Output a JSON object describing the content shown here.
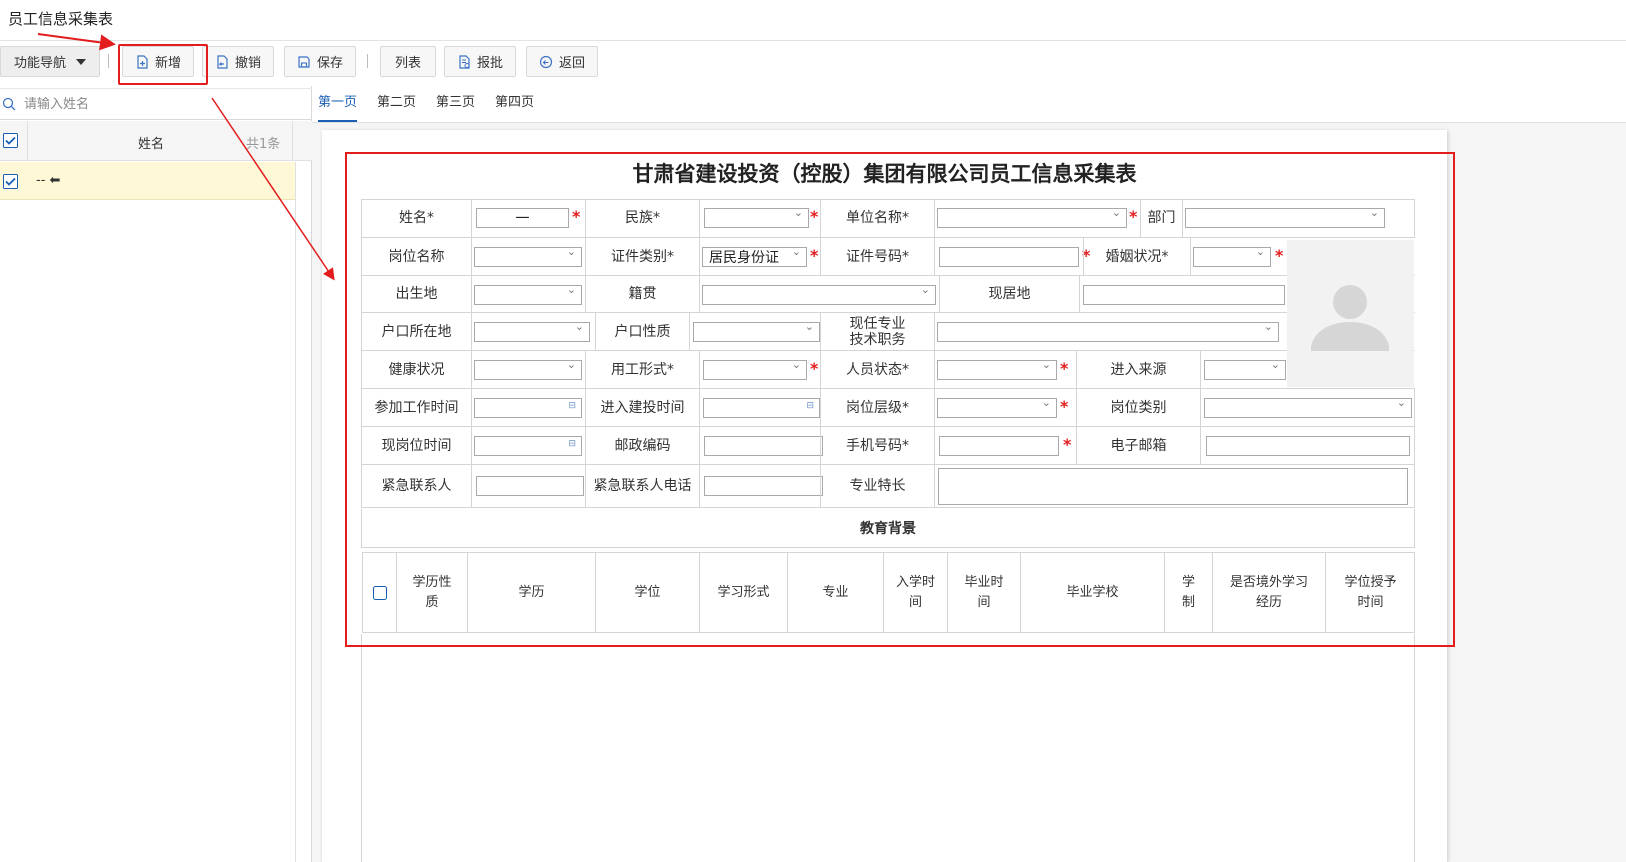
{
  "app": {
    "title": "员工信息采集表"
  },
  "toolbar": {
    "nav_label": "功能导航",
    "add_label": "新增",
    "undo_label": "撤销",
    "save_label": "保存",
    "list_label": "列表",
    "approve_label": "报批",
    "back_label": "返回"
  },
  "sidebar": {
    "search_placeholder": "请输入姓名",
    "header_name": "姓名",
    "header_count": "共1条",
    "rows": [
      {
        "name": "-- ⬅"
      }
    ]
  },
  "tabs": [
    "第一页",
    "第二页",
    "第三页",
    "第四页"
  ],
  "form": {
    "title": "甘肃省建设投资（控股）集团有限公司员工信息采集表",
    "labels": {
      "name": "姓名*",
      "ethnicity": "民族*",
      "unit": "单位名称*",
      "dept": "部门",
      "post": "岗位名称",
      "id_type": "证件类别*",
      "id_no": "证件号码*",
      "marital": "婚姻状况*",
      "birthplace": "出生地",
      "native": "籍贯",
      "residence": "现居地",
      "hukou_loc": "户口所在地",
      "hukou_type": "户口性质",
      "title_line1": "现任专业",
      "title_line2": "技术职务",
      "health": "健康状况",
      "employ_form": "用工形式*",
      "person_status": "人员状态*",
      "source": "进入来源",
      "work_start": "参加工作时间",
      "join_date": "进入建投时间",
      "post_level": "岗位层级*",
      "post_category": "岗位类别",
      "post_date": "现岗位时间",
      "postcode": "邮政编码",
      "mobile": "手机号码*",
      "email": "电子邮箱",
      "emergency": "紧急联系人",
      "emergency_phone": "紧急联系人电话",
      "specialty": "专业特长"
    },
    "values": {
      "name": "一",
      "id_type": "居民身份证"
    },
    "required_mark": "*"
  },
  "education": {
    "title": "教育背景",
    "columns": [
      "学历性\n质",
      "学历",
      "学位",
      "学习形式",
      "专业",
      "入学时\n间",
      "毕业时\n间",
      "毕业学校",
      "学\n制",
      "是否境外学习\n经历",
      "学位授予\n时间"
    ]
  },
  "colors": {
    "accent": "#1a5fb4",
    "required": "#e31d1d",
    "highlight": "#e31d1d",
    "selected_row": "#fff8d6"
  },
  "icons": {
    "search": "search-icon",
    "add": "add-doc-icon",
    "undo": "undo-icon",
    "save": "save-icon",
    "approve": "approve-icon",
    "back": "back-icon",
    "avatar": "avatar-placeholder-icon"
  }
}
